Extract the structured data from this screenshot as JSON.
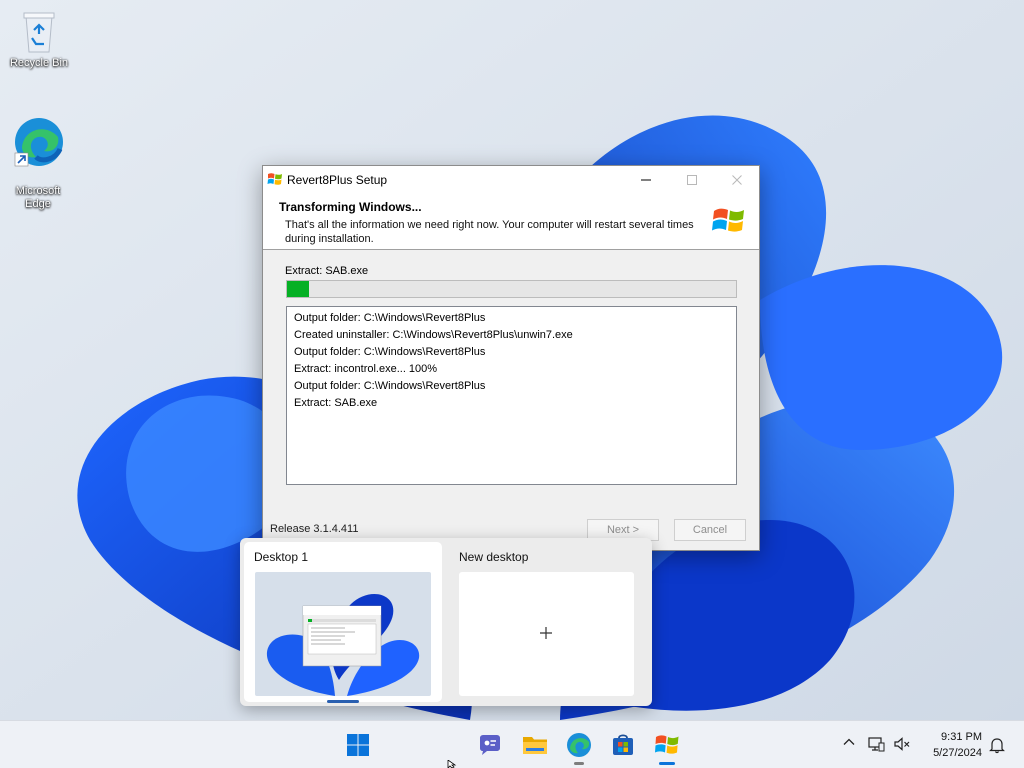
{
  "desktop": {
    "icons": [
      {
        "label": "Recycle Bin"
      },
      {
        "label": "Microsoft\nEdge"
      }
    ]
  },
  "installer": {
    "title": "Revert8Plus Setup",
    "header_title": "Transforming Windows...",
    "header_desc": "That's all the information we need right now. Your computer will restart several times during installation.",
    "status": "Extract: SAB.exe",
    "progress_percent": 5,
    "log": [
      "Output folder: C:\\Windows\\Revert8Plus",
      "Created uninstaller: C:\\Windows\\Revert8Plus\\unwin7.exe",
      "Output folder: C:\\Windows\\Revert8Plus",
      "Extract: incontrol.exe... 100%",
      "Output folder: C:\\Windows\\Revert8Plus",
      "Extract: SAB.exe"
    ],
    "release": "Release 3.1.4.411",
    "next_label": "Next >",
    "cancel_label": "Cancel"
  },
  "taskview": {
    "desktop1_label": "Desktop 1",
    "new_desktop_label": "New desktop"
  },
  "taskbar": {
    "time": "9:31 PM",
    "date": "5/27/2024",
    "icons": [
      "windows-start-icon",
      "chat-icon",
      "file-explorer-icon",
      "edge-icon",
      "store-icon",
      "revert8plus-icon"
    ]
  },
  "colors": {
    "progress_fill": "#06b025",
    "accent": "#2a5fb0"
  }
}
